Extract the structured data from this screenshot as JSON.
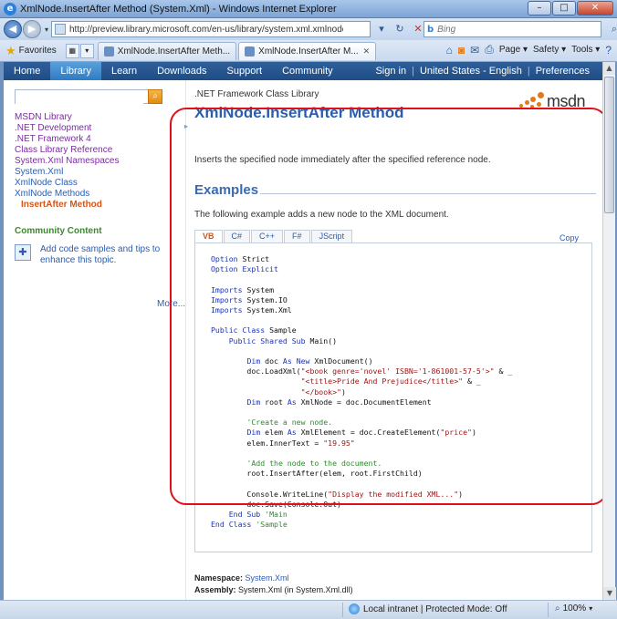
{
  "window": {
    "title": "XmlNode.InsertAfter Method (System.Xml) - Windows Internet Explorer",
    "address": "http://preview.library.microsoft.com/en-us/library/system.xml.xmlnode.insertafter(v=VS...",
    "search_placeholder": "Bing",
    "favorites_label": "Favorites",
    "tabs": [
      {
        "label": "XmlNode.InsertAfter Meth..."
      },
      {
        "label": "XmlNode.InsertAfter M..."
      }
    ],
    "tools": {
      "page": "Page ▾",
      "safety": "Safety ▾",
      "tools": "Tools ▾"
    }
  },
  "topnav": {
    "items": [
      "Home",
      "Library",
      "Learn",
      "Downloads",
      "Support",
      "Community"
    ],
    "active": "Library",
    "sign_in": "Sign in",
    "locale": "United States - English",
    "preferences": "Preferences"
  },
  "sidebar": {
    "tree": [
      {
        "label": "MSDN Library",
        "style": "visited"
      },
      {
        "label": ".NET Development",
        "style": "visited"
      },
      {
        "label": ".NET Framework 4",
        "style": "visited"
      },
      {
        "label": "Class Library Reference",
        "style": "visited"
      },
      {
        "label": "System.Xml Namespaces",
        "style": "visited"
      },
      {
        "label": "System.Xml",
        "style": "link"
      },
      {
        "label": "XmlNode Class",
        "style": "link"
      },
      {
        "label": "XmlNode Methods",
        "style": "link"
      },
      {
        "label": "InsertAfter Method",
        "style": "current"
      }
    ],
    "community_heading": "Community Content",
    "community_text": "Add code samples and tips to enhance this topic.",
    "more": "More..."
  },
  "content": {
    "library_heading": ".NET Framework Class Library",
    "title": "XmlNode.InsertAfter Method",
    "logo_text": "msdn",
    "summary": "Inserts the specified node immediately after the specified reference node.",
    "examples_heading": "Examples",
    "examples_intro": "The following example adds a new node to the XML document.",
    "code_tabs": [
      "VB",
      "C#",
      "C++",
      "F#",
      "JScript"
    ],
    "active_code_tab": "VB",
    "copy_label": "Copy",
    "namespace_label": "Namespace:",
    "namespace_value": "System.Xml",
    "assembly_label": "Assembly:",
    "assembly_value": "System.Xml (in System.Xml.dll)"
  },
  "status": {
    "zone": "Local intranet | Protected Mode: Off",
    "zoom": "100%"
  },
  "colors": {
    "accent_nav": "#1f4d86",
    "link": "#2a5db0",
    "visited": "#7a2aa0",
    "current": "#d2571b",
    "highlight_oval": "#e0101a"
  }
}
